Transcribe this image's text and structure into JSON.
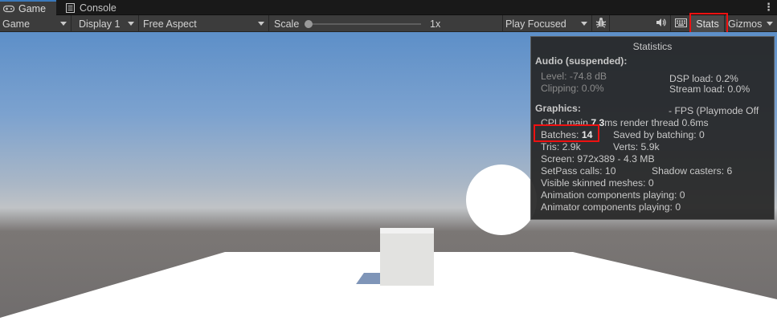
{
  "tabs": [
    {
      "label": "Game",
      "icon": "gamepad-icon",
      "active": true
    },
    {
      "label": "Console",
      "icon": "console-icon",
      "active": false
    }
  ],
  "toolbar": {
    "display_mode": "Game",
    "display": "Display 1",
    "aspect": "Free Aspect",
    "scale_label": "Scale",
    "scale_value": "1x",
    "scale_fraction": 0.0,
    "play_mode": "Play Focused",
    "stats_label": "Stats",
    "gizmos_label": "Gizmos"
  },
  "stats": {
    "title": "Statistics",
    "audio_header": "Audio (suspended):",
    "level": "Level: -74.8 dB",
    "clipping": "Clipping: 0.0%",
    "dsp_load": "DSP load: 0.2%",
    "stream_load": "Stream load: 0.0%",
    "graphics_header": "Graphics:",
    "fps": "- FPS (Playmode Off",
    "cpu_prefix": "CPU: main ",
    "cpu_main": "7.3",
    "cpu_suffix": "ms  render thread 0.6ms",
    "batches_label": "Batches: ",
    "batches_value": "14",
    "saved_by_batching": "Saved by batching: 0",
    "tris": "Tris: 2.9k",
    "verts": "Verts: 5.9k",
    "screen": "Screen: 972x389 - 4.3 MB",
    "setpass": "SetPass calls: 10",
    "shadow_casters": "Shadow casters: 6",
    "skinned": "Visible skinned meshes: 0",
    "animation": "Animation components playing: 0",
    "animator": "Animator components playing: 0"
  },
  "colors": {
    "highlight": "#e11111",
    "accent_tab": "#3a79bb"
  }
}
